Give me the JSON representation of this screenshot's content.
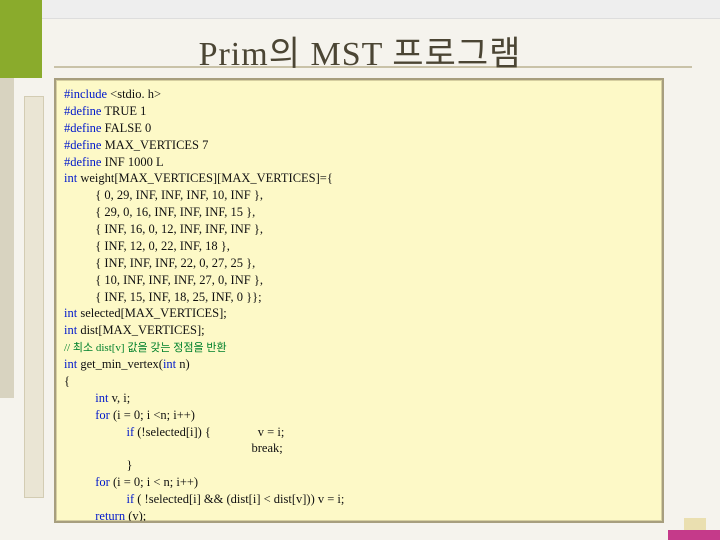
{
  "title": "Prim의 MST 프로그램",
  "code": {
    "l01a": "#include",
    "l01b": " <stdio. h>",
    "l02a": "#define",
    "l02b": " TRUE 1",
    "l03a": "#define",
    "l03b": " FALSE 0",
    "l04a": "#define",
    "l04b": " MAX_VERTICES 7",
    "l05a": "#define",
    "l05b": " INF 1000 L",
    "l06a": "int",
    "l06b": " weight[MAX_VERTICES][MAX_VERTICES]={",
    "l07": "          { 0, 29, INF, INF, INF, 10, INF },",
    "l08": "          { 29, 0, 16, INF, INF, INF, 15 },",
    "l09": "          { INF, 16, 0, 12, INF, INF, INF },",
    "l10": "          { INF, 12, 0, 22, INF, 18 },",
    "l11": "          { INF, INF, INF, 22, 0, 27, 25 },",
    "l12": "          { 10, INF, INF, INF, 27, 0, INF },",
    "l13": "          { INF, 15, INF, 18, 25, INF, 0 }};",
    "l14a": "int",
    "l14b": " selected[MAX_VERTICES];",
    "l15a": "int",
    "l15b": " dist[MAX_VERTICES];",
    "l16": "// 최소 dist[v] 값을 갖는 정점을 반환",
    "l17a": "int",
    "l17b": " get_min_vertex(",
    "l17c": "int",
    "l17d": " n)",
    "l18": "{",
    "l19a": "          int",
    "l19b": " v, i;",
    "l20a": "          for",
    "l20b": " (i = 0; i <n; i++)",
    "l21a": "                    if",
    "l21b": " (!selected[i]) {               v = i;",
    "l22": "                                                            break;",
    "l23": "                    }",
    "l24a": "          for",
    "l24b": " (i = 0; i < n; i++)",
    "l25a": "                    if",
    "l25b": " ( !selected[i] && (dist[i] < dist[v])) v = i;",
    "l26a": "          return",
    "l26b": " (v);",
    "l27": "}"
  }
}
